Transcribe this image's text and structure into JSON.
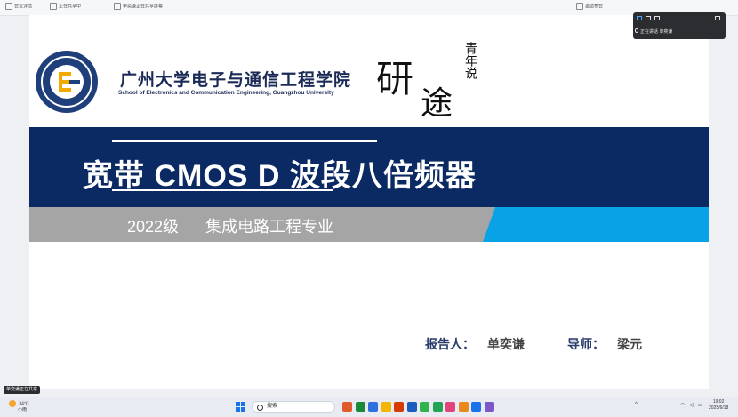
{
  "topbar": {
    "left_items": [
      "会议详情",
      "正在共享中",
      "单奕谦正在共享屏幕"
    ],
    "right_items": [
      "邀请参会",
      "文字转录",
      "设置",
      "全屏"
    ]
  },
  "slide": {
    "school_cn": "广州大学电子与通信工程学院",
    "school_en": "School of Electronics and Communication Engineering, Guangzhou University",
    "calligraphy": {
      "left": "研",
      "right": "途",
      "small": "青年说"
    },
    "title": "宽带 CMOS D 波段八倍频器",
    "subtitle": {
      "grade": "2022级",
      "major": "集成电路工程专业"
    },
    "reporter_label": "报告人：",
    "reporter_name": "单奕谦",
    "advisor_label": "导师：",
    "advisor_name": "梁元"
  },
  "meeting_panel": {
    "status": "正在讲话",
    "speaker": "单奕谦"
  },
  "share_tag": "单奕谦正在共享",
  "taskbar": {
    "weather_temp": "34°C",
    "weather_desc": "小雨",
    "search_placeholder": "搜索",
    "clock_time": "19:02",
    "clock_date": "2025/6/18",
    "app_colors": [
      "#e05a2a",
      "#1a8a3a",
      "#2f6fde",
      "#f2b600",
      "#d83b01",
      "#1e5bbf",
      "#2fb34a",
      "#23a455",
      "#e0447a",
      "#e88a1a",
      "#1a73e8",
      "#7d58c8"
    ]
  }
}
